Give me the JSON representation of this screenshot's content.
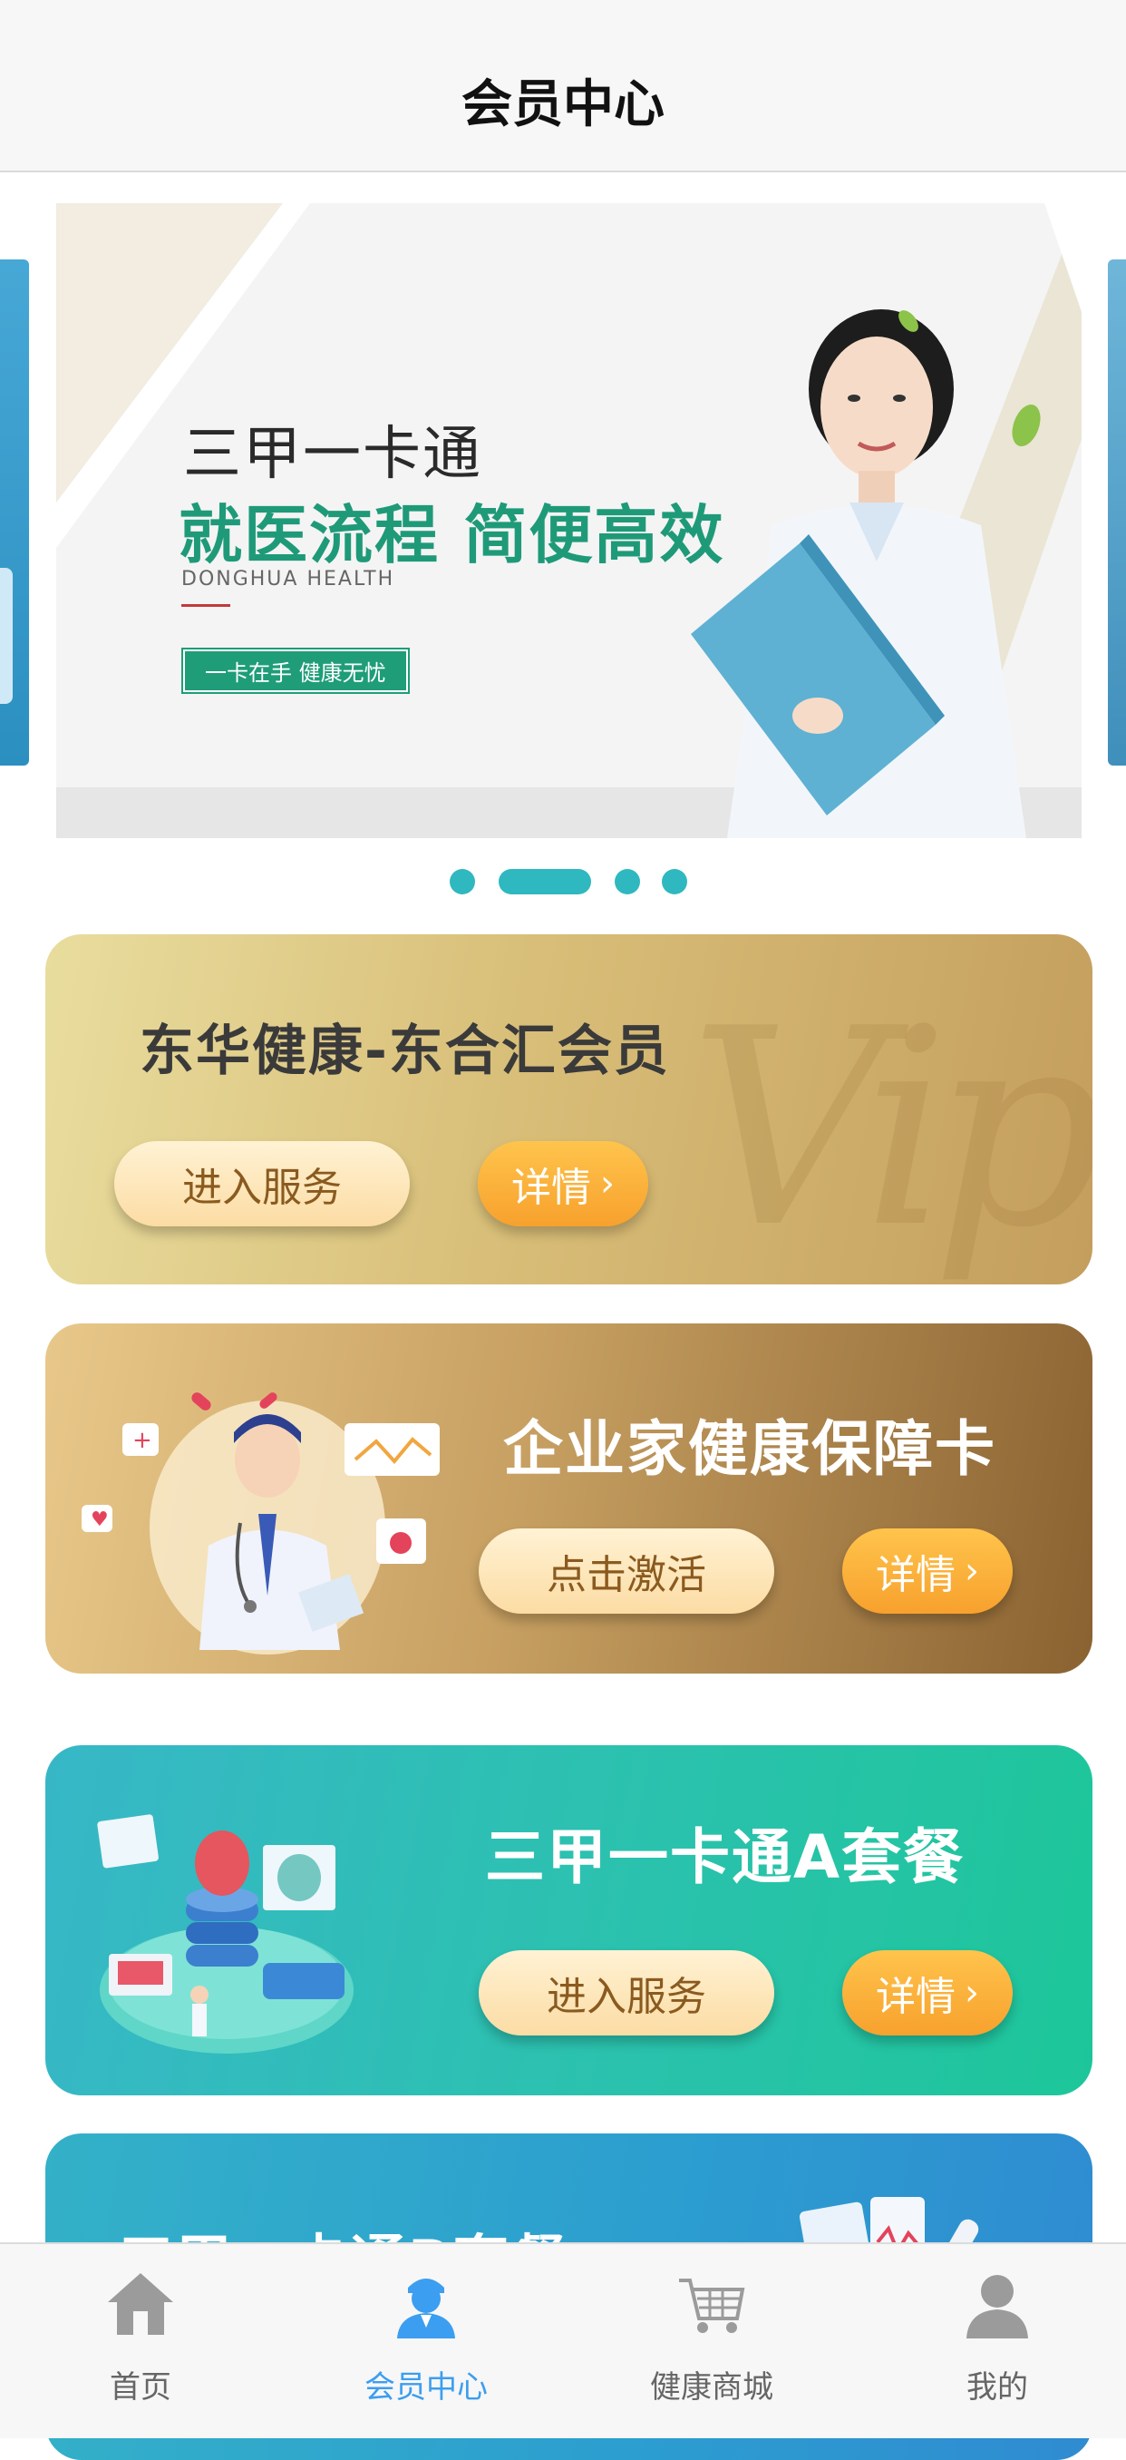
{
  "header": {
    "title": "会员中心"
  },
  "banner": {
    "line1": "三甲一卡通",
    "line2": "就医流程 简便高效",
    "line3": "DONGHUA HEALTH",
    "tag": "一卡在手 健康无忧",
    "page_count": 4,
    "active_page": 2
  },
  "cards": [
    {
      "title": "东华健康-东合汇会员",
      "primary_label": "进入服务",
      "detail_label": "详情",
      "watermark": "Vip"
    },
    {
      "title": "企业家健康保障卡",
      "primary_label": "点击激活",
      "detail_label": "详情"
    },
    {
      "title": "三甲一卡通A套餐",
      "primary_label": "进入服务",
      "detail_label": "详情"
    },
    {
      "title": "三甲一卡通B套餐"
    }
  ],
  "tabbar": {
    "items": [
      {
        "label": "首页",
        "icon": "home-icon"
      },
      {
        "label": "会员中心",
        "icon": "doctor-icon"
      },
      {
        "label": "健康商城",
        "icon": "cart-icon"
      },
      {
        "label": "我的",
        "icon": "user-icon"
      }
    ],
    "active_index": 1,
    "active_color": "#3c9ef0",
    "inactive_color": "#999999"
  },
  "colors": {
    "accent": "#2fb8c0",
    "banner_green": "#1f9a79",
    "orange": "#f7a12d"
  }
}
